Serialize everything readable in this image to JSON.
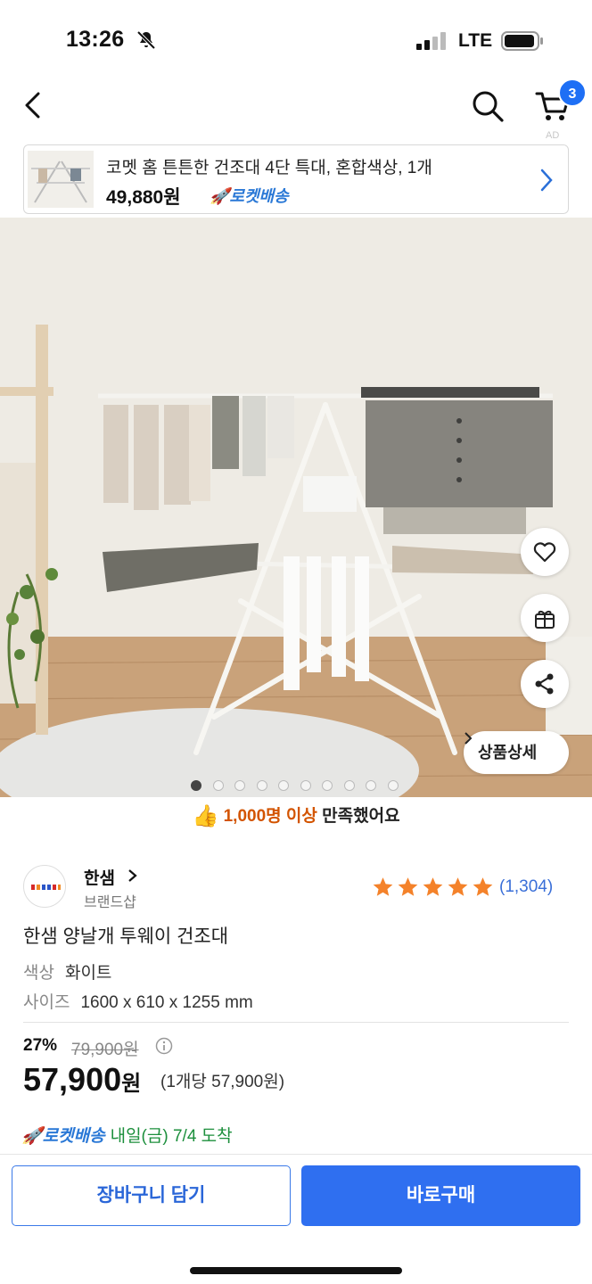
{
  "status_bar": {
    "time": "13:26",
    "network": "LTE"
  },
  "nav": {
    "cart_count": "3",
    "ad_label": "AD"
  },
  "ad_banner": {
    "title": "코멧 홈 튼튼한 건조대 4단 특대, 혼합색상, 1개",
    "price": "49,880원",
    "rocket_label": "로켓배송"
  },
  "hero": {
    "detail_button": "상품상세",
    "page_count": 10,
    "active_page": 1
  },
  "satisfaction": {
    "count": "1,000명 이상",
    "text": " 만족했어요"
  },
  "brand": {
    "name": "한샘",
    "sub": "브랜드샵",
    "rating": 5,
    "review_count": "(1,304)"
  },
  "product": {
    "name": "한샘 양날개 투웨이 건조대",
    "options": [
      {
        "key": "색상",
        "value": "화이트"
      },
      {
        "key": "사이즈",
        "value": "1600 x 610 x 1255 mm"
      }
    ],
    "discount": "27%",
    "original_price": "79,900원",
    "price": "57,900",
    "price_unit": "원",
    "unit_price": "(1개당 57,900원)"
  },
  "delivery": {
    "rocket_label": "로켓배송",
    "text": "내일(금) 7/4 도착"
  },
  "actions": {
    "cart_button": "장바구니 담기",
    "buy_button": "바로구매"
  },
  "colors": {
    "accent": "#2f6ff0",
    "orange": "#d35400",
    "star": "#f4822a"
  }
}
